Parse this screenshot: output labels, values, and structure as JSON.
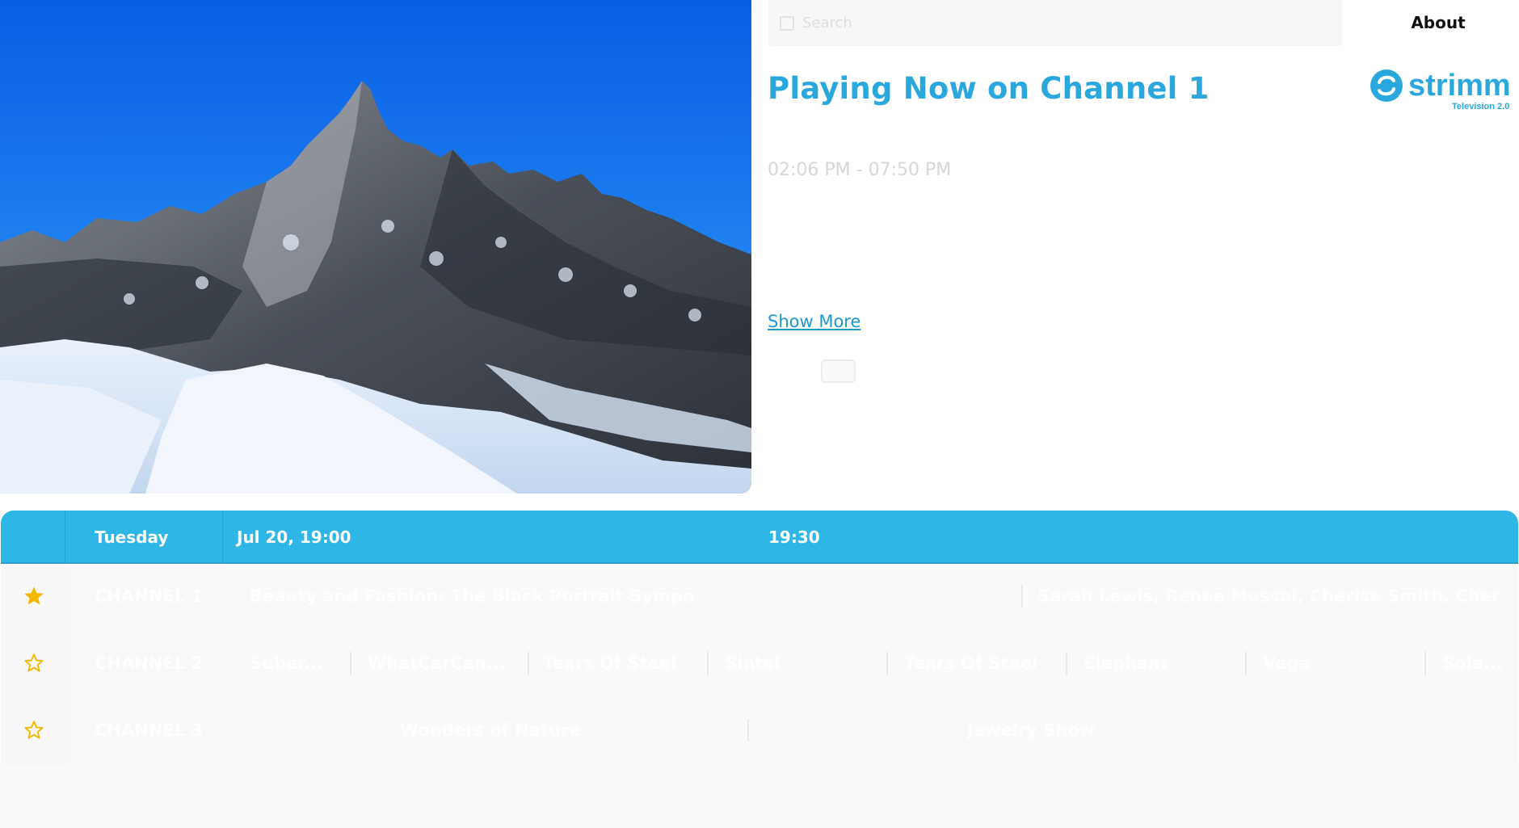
{
  "search": {
    "placeholder": "Search",
    "icon": "search-icon"
  },
  "nav": {
    "about_label": "About"
  },
  "logo": {
    "brand": "strimm",
    "tagline": "Television 2.0",
    "color": "#2aa8dd"
  },
  "now_playing": {
    "title": "Playing Now on Channel 1",
    "time_range": "02:06 PM - 07:50 PM",
    "show_more_label": "Show More"
  },
  "guide": {
    "day": "Tuesday",
    "times": [
      "Jul 20, 19:00",
      "19:30"
    ],
    "channels": [
      {
        "name": "CHANNEL 1",
        "favorite": true,
        "programs": [
          "Beauty and Fashion: The Black Portrait Sympo",
          "Sarah Lewis, Renee Mussai, Cherise Smith, Cheris..."
        ]
      },
      {
        "name": "CHANNEL 2",
        "favorite": false,
        "programs": [
          "Suber...",
          "WhatCarCan...",
          "Tears Of Steel",
          "Sintel",
          "Tears Of Steel",
          "Elephant",
          "Vega",
          "Sola..."
        ]
      },
      {
        "name": "CHANNEL 3",
        "favorite": false,
        "programs": [
          "Wonders of Nature",
          "Jewelry Show"
        ]
      }
    ]
  },
  "colors": {
    "accent": "#2db6e6",
    "title": "#2aa8dd",
    "link": "#1c98cf",
    "star": "#f5b800"
  }
}
